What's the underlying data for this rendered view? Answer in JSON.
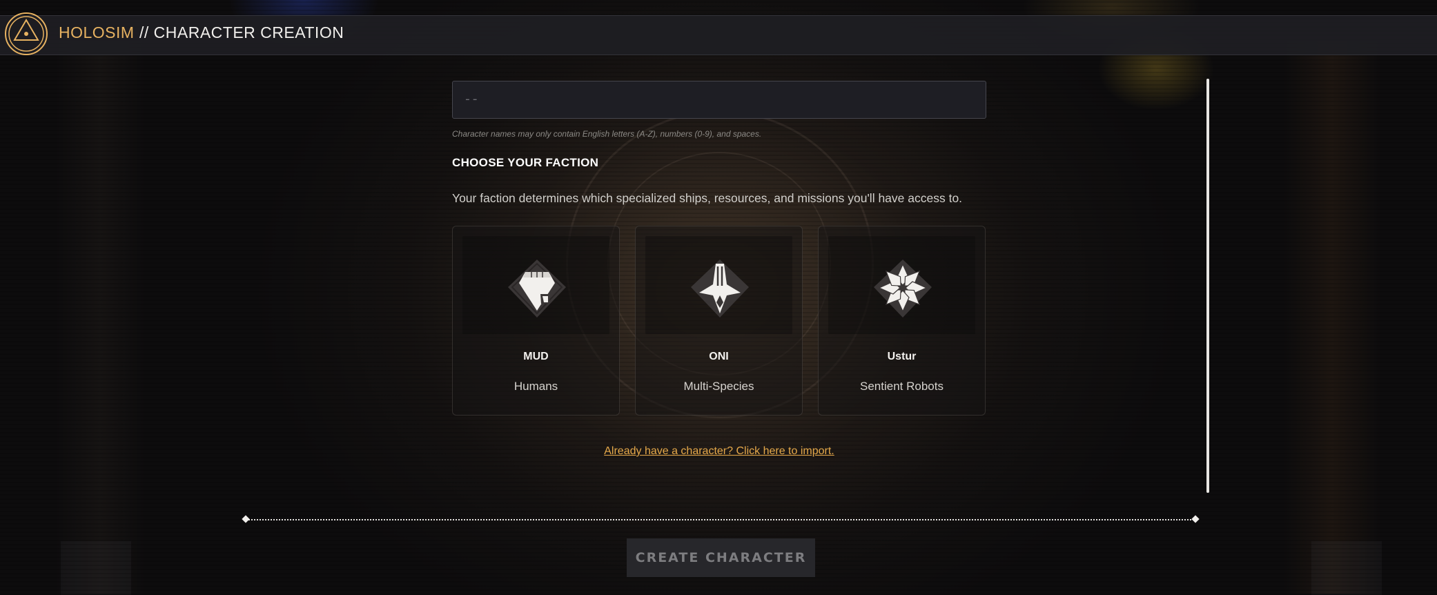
{
  "app": {
    "brand": "HOLOSIM",
    "title": "// CHARACTER CREATION"
  },
  "name_input": {
    "value": "",
    "placeholder": "--",
    "hint": "Character names may only contain English letters (A-Z), numbers (0-9), and spaces."
  },
  "faction": {
    "heading": "CHOOSE YOUR FACTION",
    "description": "Your faction determines which specialized ships, resources, and missions you'll have access to.",
    "options": [
      {
        "name": "MUD",
        "description": "Humans",
        "icon": "mud-emblem-icon"
      },
      {
        "name": "ONI",
        "description": "Multi-Species",
        "icon": "oni-emblem-icon"
      },
      {
        "name": "Ustur",
        "description": "Sentient Robots",
        "icon": "ustur-emblem-icon"
      }
    ]
  },
  "import_link": "Already have a character? Click here to import.",
  "create_button": "CREATE CHARACTER",
  "colors": {
    "brand": "#e7b261",
    "link": "#e6a94a",
    "button_bg": "#27272b",
    "button_text": "#7d7d80"
  }
}
